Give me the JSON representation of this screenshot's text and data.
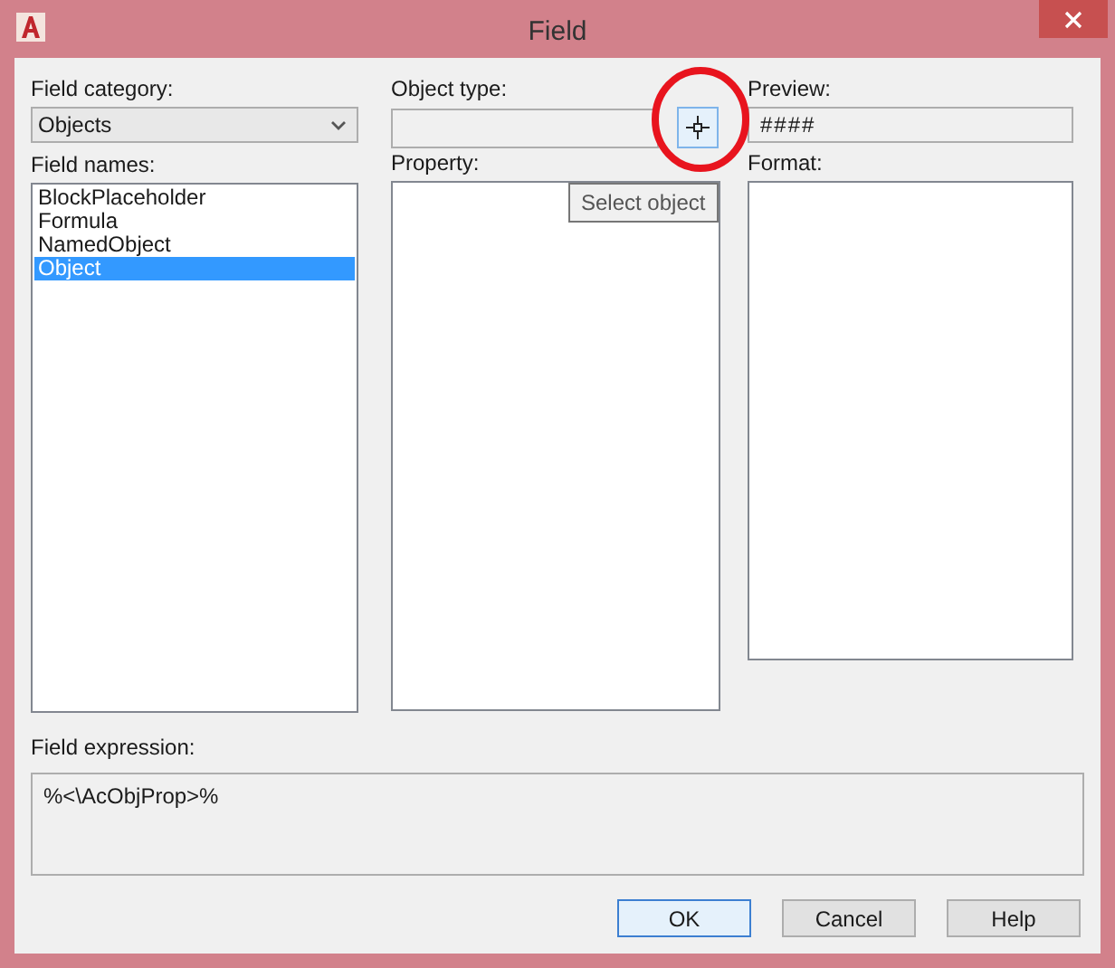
{
  "window": {
    "title": "Field"
  },
  "field_category": {
    "label": "Field category:",
    "value": "Objects"
  },
  "field_names": {
    "label": "Field names:",
    "items": [
      {
        "label": "BlockPlaceholder",
        "selected": false
      },
      {
        "label": "Formula",
        "selected": false
      },
      {
        "label": "NamedObject",
        "selected": false
      },
      {
        "label": "Object",
        "selected": true
      }
    ]
  },
  "object_type": {
    "label": "Object type:"
  },
  "select_object_tooltip": "Select object",
  "property": {
    "label": "Property:"
  },
  "preview": {
    "label": "Preview:",
    "value": "####"
  },
  "format": {
    "label": "Format:"
  },
  "field_expression": {
    "label": "Field expression:",
    "value": "%<\\AcObjProp>%"
  },
  "buttons": [
    {
      "label": "OK",
      "default": true
    },
    {
      "label": "Cancel",
      "default": false
    },
    {
      "label": "Help",
      "default": false
    }
  ]
}
